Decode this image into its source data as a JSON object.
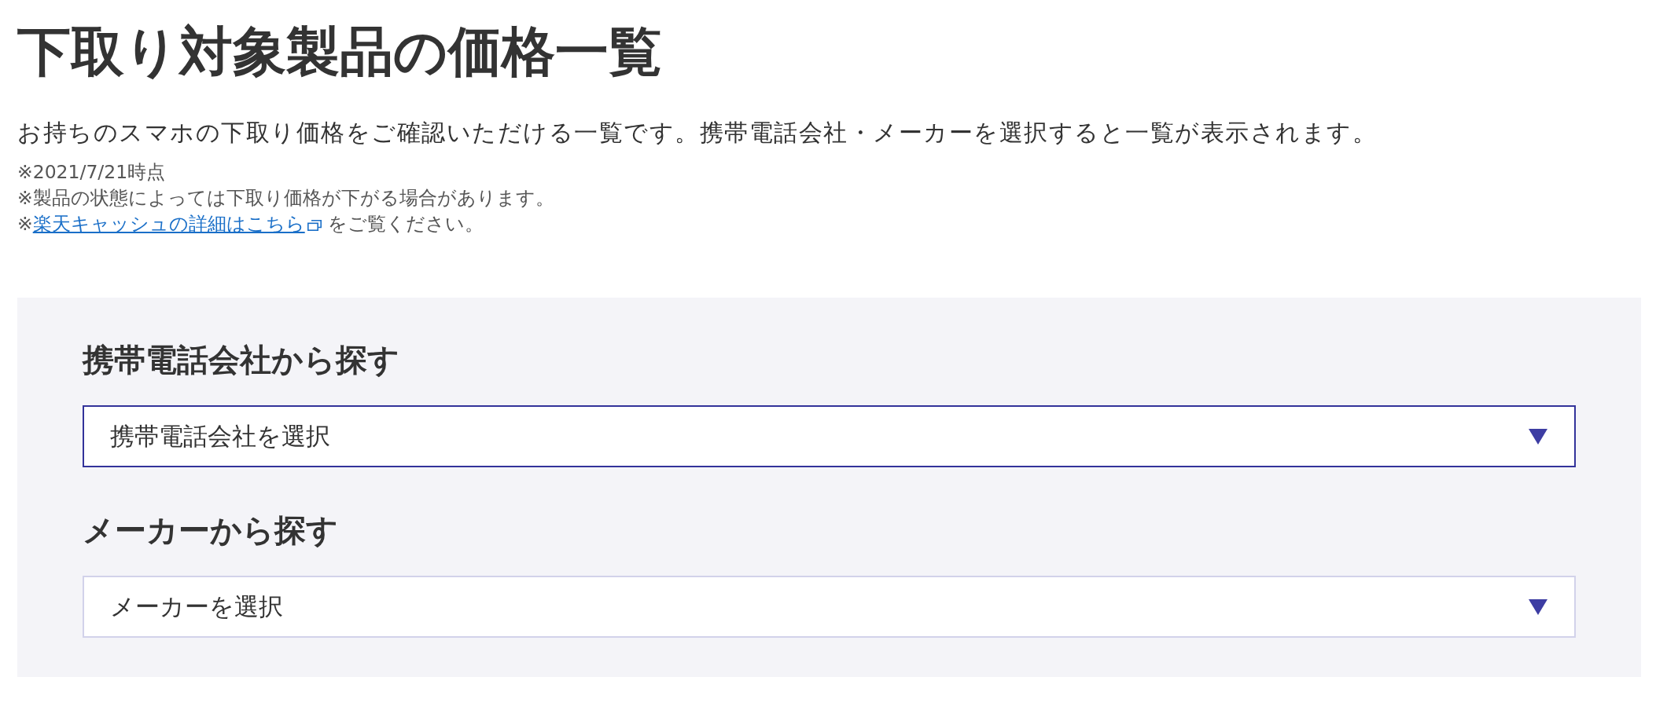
{
  "page": {
    "title": "下取り対象製品の価格一覧",
    "description": "お持ちのスマホの下取り価格をご確認いただける一覧です。携帯電話会社・メーカーを選択すると一覧が表示されます。",
    "notes": [
      {
        "kind": "text",
        "text": "※2021/7/21時点"
      },
      {
        "kind": "text",
        "text": "※製品の状態によっては下取り価格が下がる場合があります。"
      },
      {
        "kind": "link",
        "prefix": "※",
        "link": "楽天キャッシュの詳細はこちら",
        "suffix": "をご覧ください。"
      }
    ]
  },
  "search": {
    "sections": [
      {
        "heading": "携帯電話会社から探す",
        "select": {
          "value": "携帯電話会社を選択",
          "focused": true
        }
      },
      {
        "heading": "メーカーから探す",
        "select": {
          "value": "メーカーを選択",
          "focused": false
        }
      }
    ]
  }
}
